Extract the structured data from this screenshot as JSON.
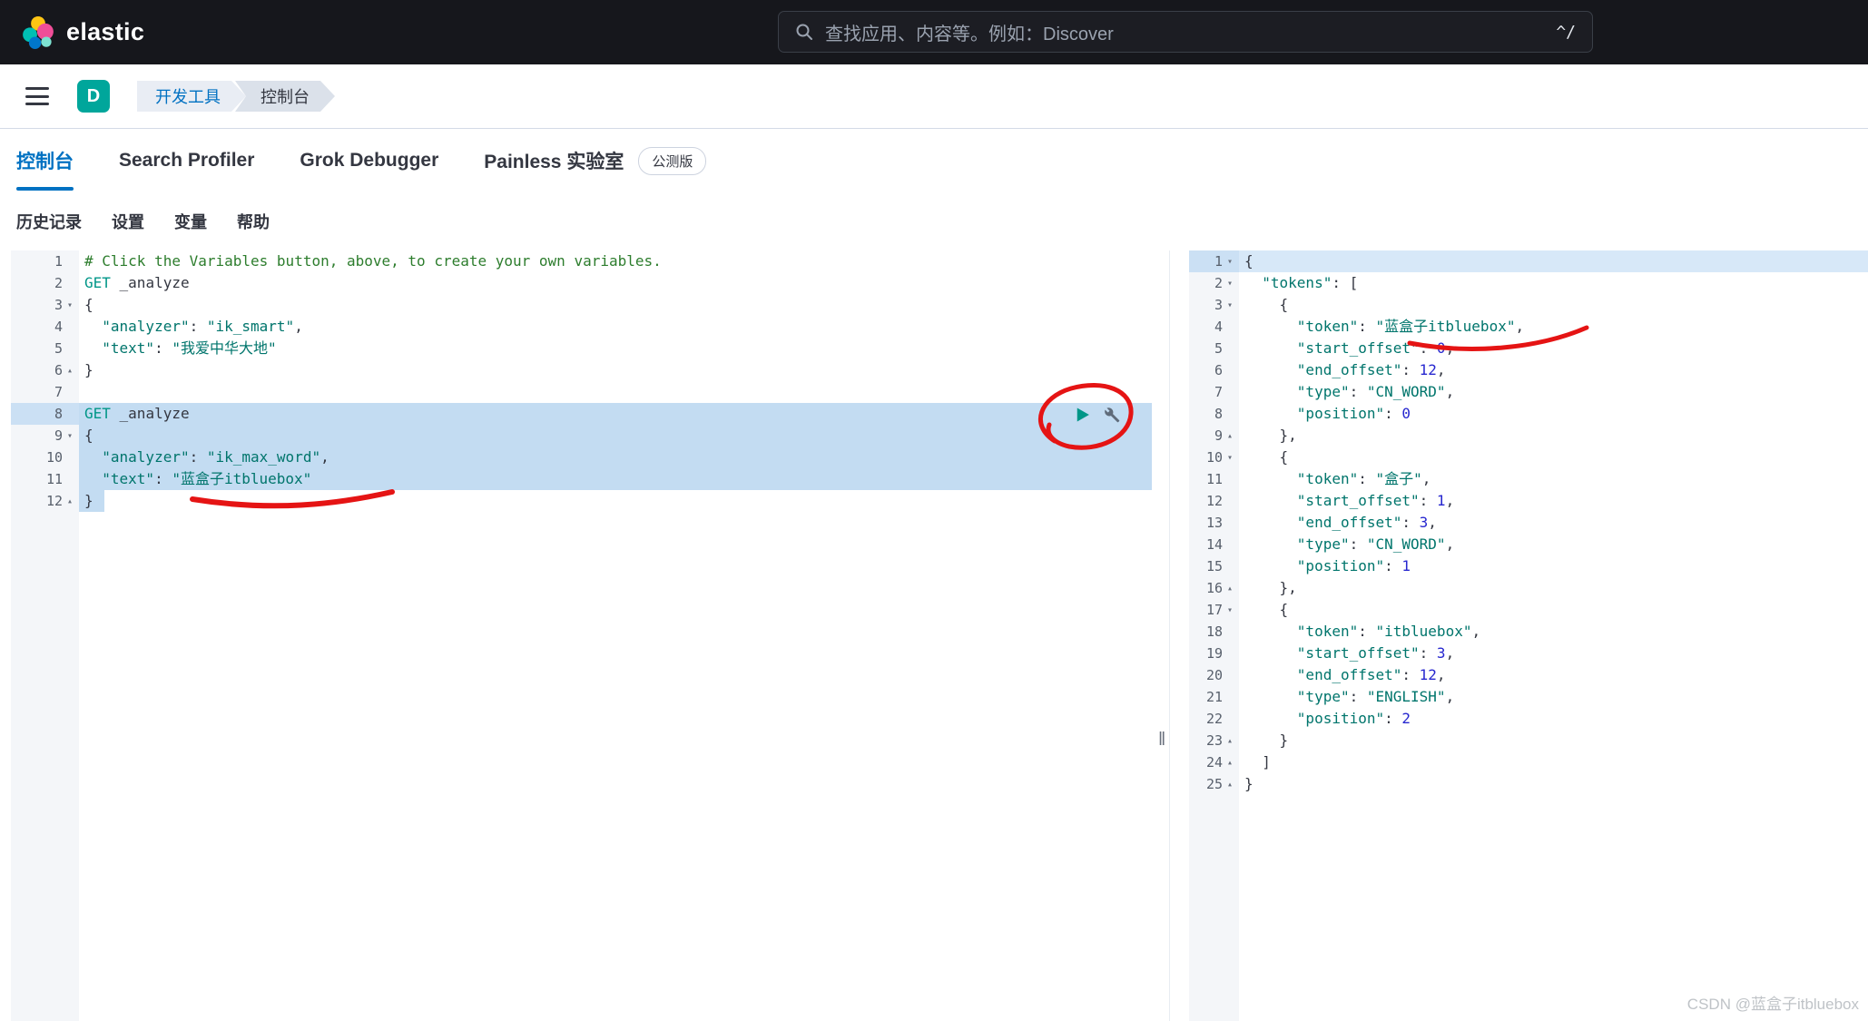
{
  "topbar": {
    "brand": "elastic",
    "search": {
      "placeholder": "查找应用、内容等。例如：Discover",
      "shortcut": "^/"
    }
  },
  "nav": {
    "space_badge": "D",
    "breadcrumbs": [
      "开发工具",
      "控制台"
    ]
  },
  "tabs": [
    {
      "label": "控制台",
      "active": true
    },
    {
      "label": "Search Profiler",
      "active": false
    },
    {
      "label": "Grok Debugger",
      "active": false
    },
    {
      "label": "Painless 实验室",
      "active": false,
      "badge": "公测版"
    }
  ],
  "toolbar": [
    "历史记录",
    "设置",
    "变量",
    "帮助"
  ],
  "editor": {
    "lines": [
      {
        "n": 1,
        "seg": [
          [
            "c",
            "# Click the Variables button, above, to create your own variables."
          ]
        ]
      },
      {
        "n": 2,
        "seg": [
          [
            "m",
            "GET"
          ],
          [
            "u",
            " _analyze"
          ]
        ]
      },
      {
        "n": 3,
        "fold": "d",
        "seg": [
          [
            "p",
            "{"
          ]
        ]
      },
      {
        "n": 4,
        "seg": [
          [
            "p",
            "  "
          ],
          [
            "k",
            "\"analyzer\""
          ],
          [
            "p",
            ": "
          ],
          [
            "s",
            "\"ik_smart\""
          ],
          [
            "p",
            ","
          ]
        ]
      },
      {
        "n": 5,
        "seg": [
          [
            "p",
            "  "
          ],
          [
            "k",
            "\"text\""
          ],
          [
            "p",
            ": "
          ],
          [
            "s",
            "\"我爱中华大地\""
          ]
        ]
      },
      {
        "n": 6,
        "fold": "u",
        "seg": [
          [
            "p",
            "}"
          ]
        ]
      },
      {
        "n": 7,
        "seg": []
      },
      {
        "n": 8,
        "hl": "full",
        "ghl": true,
        "seg": [
          [
            "m",
            "GET"
          ],
          [
            "u",
            " _analyze"
          ]
        ]
      },
      {
        "n": 9,
        "fold": "d",
        "hl": "full",
        "seg": [
          [
            "p",
            "{"
          ]
        ]
      },
      {
        "n": 10,
        "hl": "full",
        "seg": [
          [
            "p",
            "  "
          ],
          [
            "k",
            "\"analyzer\""
          ],
          [
            "p",
            ": "
          ],
          [
            "s",
            "\"ik_max_word\""
          ],
          [
            "p",
            ","
          ]
        ]
      },
      {
        "n": 11,
        "hl": "full",
        "seg": [
          [
            "p",
            "  "
          ],
          [
            "k",
            "\"text\""
          ],
          [
            "p",
            ": "
          ],
          [
            "s",
            "\"蓝盒子itbluebox\""
          ]
        ]
      },
      {
        "n": 12,
        "fold": "u",
        "hl": "partial",
        "seg": [
          [
            "p",
            "}"
          ]
        ]
      }
    ]
  },
  "output": {
    "lines": [
      {
        "n": 1,
        "fold": "d",
        "hl": "full",
        "ghl": true,
        "seg": [
          [
            "p",
            "{"
          ]
        ]
      },
      {
        "n": 2,
        "fold": "d",
        "seg": [
          [
            "p",
            "  "
          ],
          [
            "k",
            "\"tokens\""
          ],
          [
            "p",
            ": ["
          ]
        ]
      },
      {
        "n": 3,
        "fold": "d",
        "seg": [
          [
            "p",
            "    {"
          ]
        ]
      },
      {
        "n": 4,
        "seg": [
          [
            "p",
            "      "
          ],
          [
            "k",
            "\"token\""
          ],
          [
            "p",
            ": "
          ],
          [
            "s",
            "\"蓝盒子itbluebox\""
          ],
          [
            "p",
            ","
          ]
        ]
      },
      {
        "n": 5,
        "seg": [
          [
            "p",
            "      "
          ],
          [
            "k",
            "\"start_offset\""
          ],
          [
            "p",
            ": "
          ],
          [
            "num",
            "0"
          ],
          [
            "p",
            ","
          ]
        ]
      },
      {
        "n": 6,
        "seg": [
          [
            "p",
            "      "
          ],
          [
            "k",
            "\"end_offset\""
          ],
          [
            "p",
            ": "
          ],
          [
            "num",
            "12"
          ],
          [
            "p",
            ","
          ]
        ]
      },
      {
        "n": 7,
        "seg": [
          [
            "p",
            "      "
          ],
          [
            "k",
            "\"type\""
          ],
          [
            "p",
            ": "
          ],
          [
            "s",
            "\"CN_WORD\""
          ],
          [
            "p",
            ","
          ]
        ]
      },
      {
        "n": 8,
        "seg": [
          [
            "p",
            "      "
          ],
          [
            "k",
            "\"position\""
          ],
          [
            "p",
            ": "
          ],
          [
            "num",
            "0"
          ]
        ]
      },
      {
        "n": 9,
        "fold": "u",
        "seg": [
          [
            "p",
            "    },"
          ]
        ]
      },
      {
        "n": 10,
        "fold": "d",
        "seg": [
          [
            "p",
            "    {"
          ]
        ]
      },
      {
        "n": 11,
        "seg": [
          [
            "p",
            "      "
          ],
          [
            "k",
            "\"token\""
          ],
          [
            "p",
            ": "
          ],
          [
            "s",
            "\"盒子\""
          ],
          [
            "p",
            ","
          ]
        ]
      },
      {
        "n": 12,
        "seg": [
          [
            "p",
            "      "
          ],
          [
            "k",
            "\"start_offset\""
          ],
          [
            "p",
            ": "
          ],
          [
            "num",
            "1"
          ],
          [
            "p",
            ","
          ]
        ]
      },
      {
        "n": 13,
        "seg": [
          [
            "p",
            "      "
          ],
          [
            "k",
            "\"end_offset\""
          ],
          [
            "p",
            ": "
          ],
          [
            "num",
            "3"
          ],
          [
            "p",
            ","
          ]
        ]
      },
      {
        "n": 14,
        "seg": [
          [
            "p",
            "      "
          ],
          [
            "k",
            "\"type\""
          ],
          [
            "p",
            ": "
          ],
          [
            "s",
            "\"CN_WORD\""
          ],
          [
            "p",
            ","
          ]
        ]
      },
      {
        "n": 15,
        "seg": [
          [
            "p",
            "      "
          ],
          [
            "k",
            "\"position\""
          ],
          [
            "p",
            ": "
          ],
          [
            "num",
            "1"
          ]
        ]
      },
      {
        "n": 16,
        "fold": "u",
        "seg": [
          [
            "p",
            "    },"
          ]
        ]
      },
      {
        "n": 17,
        "fold": "d",
        "seg": [
          [
            "p",
            "    {"
          ]
        ]
      },
      {
        "n": 18,
        "seg": [
          [
            "p",
            "      "
          ],
          [
            "k",
            "\"token\""
          ],
          [
            "p",
            ": "
          ],
          [
            "s",
            "\"itbluebox\""
          ],
          [
            "p",
            ","
          ]
        ]
      },
      {
        "n": 19,
        "seg": [
          [
            "p",
            "      "
          ],
          [
            "k",
            "\"start_offset\""
          ],
          [
            "p",
            ": "
          ],
          [
            "num",
            "3"
          ],
          [
            "p",
            ","
          ]
        ]
      },
      {
        "n": 20,
        "seg": [
          [
            "p",
            "      "
          ],
          [
            "k",
            "\"end_offset\""
          ],
          [
            "p",
            ": "
          ],
          [
            "num",
            "12"
          ],
          [
            "p",
            ","
          ]
        ]
      },
      {
        "n": 21,
        "seg": [
          [
            "p",
            "      "
          ],
          [
            "k",
            "\"type\""
          ],
          [
            "p",
            ": "
          ],
          [
            "s",
            "\"ENGLISH\""
          ],
          [
            "p",
            ","
          ]
        ]
      },
      {
        "n": 22,
        "seg": [
          [
            "p",
            "      "
          ],
          [
            "k",
            "\"position\""
          ],
          [
            "p",
            ": "
          ],
          [
            "num",
            "2"
          ]
        ]
      },
      {
        "n": 23,
        "fold": "u",
        "seg": [
          [
            "p",
            "    }"
          ]
        ]
      },
      {
        "n": 24,
        "fold": "u",
        "seg": [
          [
            "p",
            "  ]"
          ]
        ]
      },
      {
        "n": 25,
        "fold": "u",
        "seg": [
          [
            "p",
            "}"
          ]
        ]
      }
    ]
  },
  "divider_handle": "‖",
  "watermark": "CSDN @蓝盒子itbluebox",
  "colors": {
    "accent_blue": "#0071c2",
    "space_badge_teal": "#00a69b",
    "selection_blue": "#c3dcf2",
    "annotation_red": "#e51414",
    "syntax_method": "#009688",
    "syntax_string": "#00756c",
    "syntax_number": "#2727cf",
    "syntax_comment": "#2d7d2d"
  }
}
